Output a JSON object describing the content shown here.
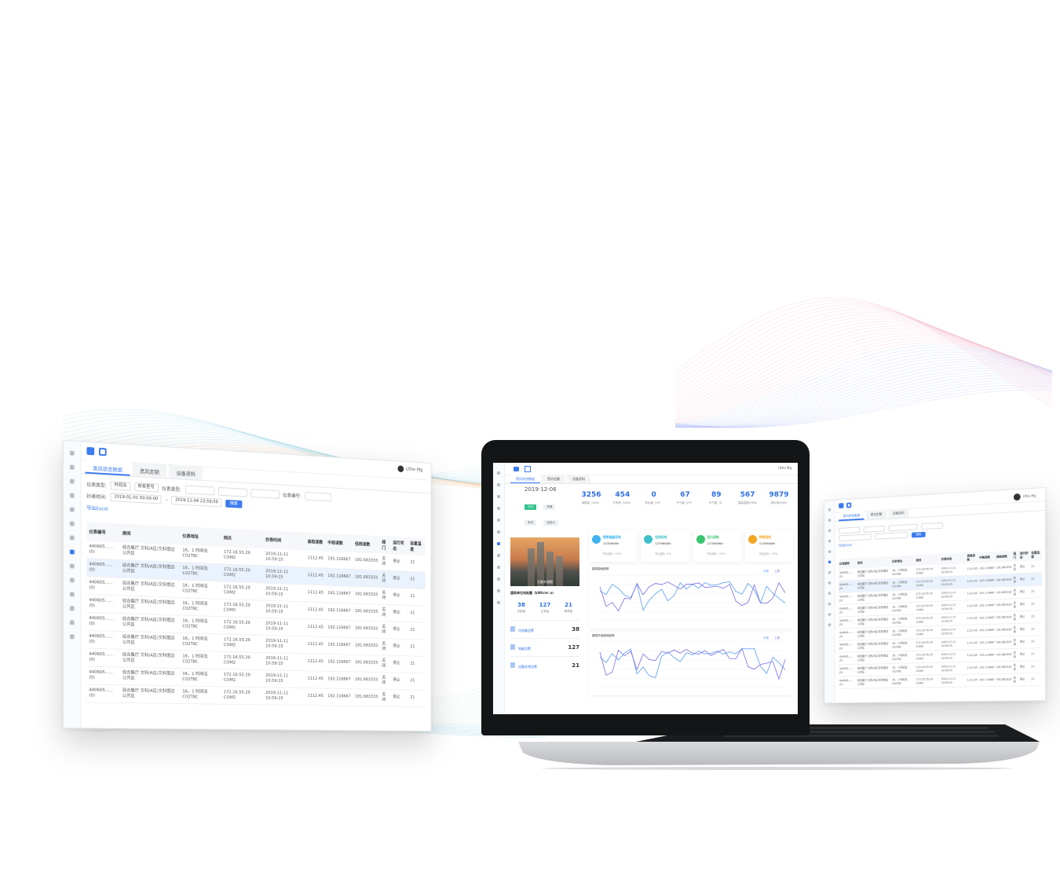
{
  "left_screen": {
    "tabs": [
      "黑风状态数据",
      "黑风定额",
      "设备资料"
    ],
    "user": "Uthe Mg",
    "filters": {
      "meter_type_label": "仪表类型:",
      "meter_type_value": "时间法",
      "model_value": "所有型号",
      "meter_kind_label": "仪表类型:",
      "meter_no_label": "仪表编号:",
      "time_label": "抄表时间:",
      "time_from": "2019-01-01 00:00:00",
      "time_to": "2019-12-04 23:59:59",
      "search_btn": "搜索",
      "export": "导出Excel"
    },
    "columns": [
      "仪表编号",
      "房间",
      "仪表地址",
      "网关",
      "抄表时间",
      "高档读数",
      "中档读数",
      "低档读数",
      "阀门",
      "运行状态",
      "设置温度"
    ],
    "rows": [
      [
        "440605......(0)",
        "综合集厅 文科/A区/文科馆边公共区",
        "16，1 时间法C02T8C",
        "172.16.55.29 COM2",
        "2019-11-11 10:59:15",
        "1112.45",
        "192.116667",
        "181.683333",
        "关闭",
        "停止",
        "21"
      ],
      [
        "440605......(0)",
        "综合集厅 文科/A区/文科馆边公共区",
        "16，1 时间法C02T8C",
        "172.16.55.29 COM2",
        "2019-11-11 10:59:15",
        "1112.45",
        "192.116667",
        "181.683333",
        "关闭",
        "停止",
        "21"
      ],
      [
        "440605......(0)",
        "综合集厅 文科/A区/文科馆边公共区",
        "16，1 时间法C02T8C",
        "172.16.55.29 COM2",
        "2019-11-11 10:59:15",
        "1112.45",
        "192.116667",
        "181.683333",
        "关闭",
        "停止",
        "21"
      ],
      [
        "440605......(0)",
        "综合集厅 文科/A区/文科馆边公共区",
        "16，1 时间法C02T8C",
        "172.16.55.29 COM2",
        "2019-11-11 10:59:15",
        "1112.45",
        "192.116667",
        "181.683333",
        "关闭",
        "停止",
        "21"
      ],
      [
        "440605......(0)",
        "综合集厅 文科/A区/文科馆边公共区",
        "16，1 时间法C02T8C",
        "172.16.55.29 COM2",
        "2019-11-11 10:59:15",
        "1112.45",
        "192.116667",
        "181.683333",
        "关闭",
        "停止",
        "21"
      ],
      [
        "440605......(0)",
        "综合集厅 文科/A区/文科馆边公共区",
        "16，1 时间法C02T8C",
        "172.16.55.29 COM2",
        "2019-11-11 10:59:15",
        "1112.45",
        "192.116667",
        "181.683333",
        "关闭",
        "停止",
        "21"
      ],
      [
        "440605......(0)",
        "综合集厅 文科/A区/文科馆边公共区",
        "16，1 时间法C02T8C",
        "172.16.55.29 COM2",
        "2019-11-11 10:59:15",
        "1112.45",
        "192.116667",
        "181.683333",
        "关闭",
        "停止",
        "21"
      ],
      [
        "440605......(0)",
        "综合集厅 文科/A区/文科馆边公共区",
        "16，1 时间法C02T8C",
        "172.16.55.29 COM2",
        "2019-11-11 10:59:15",
        "1112.45",
        "192.116667",
        "181.683333",
        "关闭",
        "停止",
        "21"
      ],
      [
        "440605......(0)",
        "综合集厅 文科/A区/文科馆边公共区",
        "16，1 时间法C02T8C",
        "172.16.55.29 COM2",
        "2019-11-11 10:59:15",
        "1112.45",
        "192.116667",
        "181.683333",
        "关闭",
        "停止",
        "21"
      ]
    ]
  },
  "dashboard": {
    "tabs": [
      "黑风状态数据",
      "黑风定额",
      "设备资料"
    ],
    "user": "Uthe Mg",
    "date": "2019-12-06",
    "tags": [
      "今日",
      "本周",
      "本月",
      "自定义"
    ],
    "stats": [
      {
        "value": "3256",
        "label": "电耗量（kwh）"
      },
      {
        "value": "454",
        "label": "冷负荷（kWh）"
      },
      {
        "value": "0",
        "label": "热水量（m³）"
      },
      {
        "value": "67",
        "label": "冷气量（m³）"
      },
      {
        "value": "89",
        "label": "冷气量（t）"
      },
      {
        "value": "567",
        "label": "温高温差(kWh)"
      },
      {
        "value": "9879",
        "label": "用水电(kWh)"
      }
    ],
    "photo_caption": "大厦外观图",
    "efficiency_label": "建筑单位电耗量（kWh/m².a）",
    "summary": [
      {
        "value": "38",
        "label": "总数量"
      },
      {
        "value": "127",
        "label": "正常量"
      },
      {
        "value": "21",
        "label": "故障量"
      }
    ],
    "alerts": [
      {
        "label": "冷热量告警",
        "count": "38"
      },
      {
        "label": "电能告警",
        "count": "127"
      },
      {
        "label": "设备异常告警",
        "count": "21"
      }
    ],
    "cards": [
      {
        "title": "照明插座用电",
        "value": "12356kWh",
        "compare": "环比增长 +13%",
        "color": "#3fb3f0"
      },
      {
        "title": "空调用电",
        "value": "12356kWh",
        "compare": "环比增长 -5%",
        "color": "#3fc1c9"
      },
      {
        "title": "动力用电",
        "value": "12356kWh",
        "compare": "环比增长 +12%",
        "color": "#39c66e"
      },
      {
        "title": "特殊用电",
        "value": "12356kWh",
        "compare": "环比增长 +13%",
        "color": "#f5a623"
      }
    ],
    "chart1_title": "建筑能耗趋势",
    "chart2_title": "建筑热电能耗趋势",
    "legend": [
      "本期",
      "上期"
    ]
  },
  "right_screen": {
    "tabs": [
      "黑风状态数据",
      "黑风定额",
      "设备资料"
    ],
    "user": "Uthe Mg",
    "search_btn": "搜索",
    "export": "导出Excel",
    "columns": [
      "仪表编号",
      "房间",
      "仪表地址",
      "网关",
      "抄表时间",
      "高档读数",
      "中档读数",
      "低档读数",
      "阀门",
      "运行状态",
      "设置温度"
    ],
    "rows": [
      [
        "440605......(0)",
        "综合集厅 文科/A区/文科馆边公共区",
        "16，1 时间法C02T8C",
        "172.16.55.29 COM2",
        "2019-11-11 10:59:15",
        "1112.45",
        "192.116667",
        "181.683333",
        "关闭",
        "停止",
        "21"
      ],
      [
        "440605......(0)",
        "综合集厅 文科/A区/文科馆边公共区",
        "16，1 时间法C02T8C",
        "172.16.55.29 COM2",
        "2019-11-11 10:59:15",
        "1112.45",
        "192.116667",
        "181.683333",
        "关闭",
        "停止",
        "21"
      ],
      [
        "440605......(0)",
        "综合集厅 文科/A区/文科馆边公共区",
        "16，1 时间法C02T8C",
        "172.16.55.29 COM2",
        "2019-11-11 10:59:15",
        "1112.45",
        "192.116667",
        "181.683333",
        "关闭",
        "停止",
        "21"
      ],
      [
        "440605......(0)",
        "综合集厅 文科/A区/文科馆边公共区",
        "16，1 时间法C02T8C",
        "172.16.55.29 COM2",
        "2019-11-11 10:59:15",
        "1112.45",
        "192.116667",
        "181.683333",
        "关闭",
        "停止",
        "21"
      ],
      [
        "440605......(0)",
        "综合集厅 文科/A区/文科馆边公共区",
        "16，1 时间法C02T8C",
        "172.16.55.29 COM2",
        "2019-11-11 10:59:15",
        "1112.45",
        "192.116667",
        "181.683333",
        "关闭",
        "停止",
        "21"
      ],
      [
        "440605......(0)",
        "综合集厅 文科/A区/文科馆边公共区",
        "16，1 时间法C02T8C",
        "172.16.55.29 COM2",
        "2019-11-11 10:59:15",
        "1112.45",
        "192.116667",
        "181.683333",
        "关闭",
        "停止",
        "21"
      ],
      [
        "440605......(0)",
        "综合集厅 文科/A区/文科馆边公共区",
        "16，1 时间法C02T8C",
        "172.16.55.29 COM2",
        "2019-11-11 10:59:15",
        "1112.45",
        "192.116667",
        "181.683333",
        "关闭",
        "停止",
        "21"
      ],
      [
        "440605......(0)",
        "综合集厅 文科/A区/文科馆边公共区",
        "16，1 时间法C02T8C",
        "172.16.55.29 COM2",
        "2019-11-11 10:59:15",
        "1112.45",
        "192.116667",
        "181.683333",
        "关闭",
        "停止",
        "21"
      ],
      [
        "440605......(0)",
        "综合集厅 文科/A区/文科馆边公共区",
        "16，1 时间法C02T8C",
        "172.16.55.29 COM2",
        "2019-11-11 10:59:15",
        "1112.45",
        "192.116667",
        "181.683333",
        "关闭",
        "停止",
        "21"
      ],
      [
        "440605......(0)",
        "综合集厅 文科/A区/文科馆边公共区",
        "16，1 时间法C02T8C",
        "172.16.55.29 COM2",
        "2019-11-11 10:59:15",
        "1112.45",
        "192.116667",
        "181.683333",
        "关闭",
        "停止",
        "21"
      ]
    ]
  },
  "colors": {
    "accent": "#3c7bf0",
    "chart_line_a": "#6aa7f2",
    "chart_line_b": "#8c7ae6"
  }
}
